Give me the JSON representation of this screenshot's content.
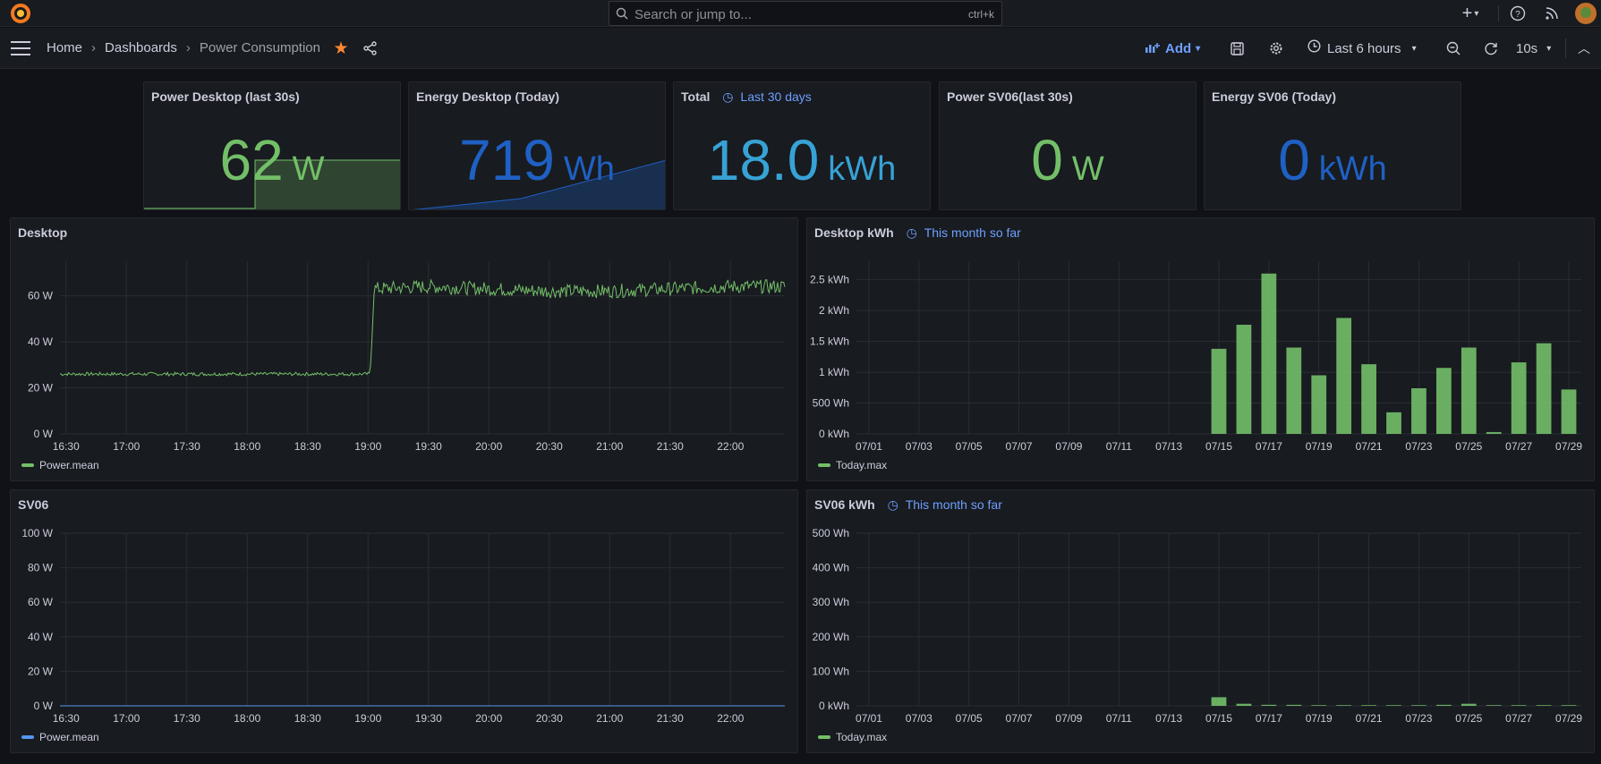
{
  "topbar": {
    "search_placeholder": "Search or jump to...",
    "search_shortcut": "ctrl+k",
    "add_icon": "plus-icon",
    "help_icon": "help-circle-icon",
    "news_icon": "rss-icon"
  },
  "breadcrumb": {
    "home": "Home",
    "dashboards": "Dashboards",
    "current": "Power Consumption"
  },
  "toolbar": {
    "add_label": "Add",
    "time_range": "Last 6 hours",
    "refresh_interval": "10s"
  },
  "colors": {
    "green": "#73bf69",
    "blue": "#1f60c4",
    "lightblue": "#37a2d5",
    "star": "#ff8833",
    "link": "#6e9fff"
  },
  "stat_panels": [
    {
      "title": "Power Desktop (last 30s)",
      "value": "62",
      "unit": "W",
      "color": "#73bf69"
    },
    {
      "title": "Energy Desktop (Today)",
      "value": "719",
      "unit": "Wh",
      "color": "#1f60c4"
    },
    {
      "title": "Total",
      "time_info": "Last 30 days",
      "value": "18.0",
      "unit": "kWh",
      "color": "#37a2d5"
    },
    {
      "title": "Power SV06(last 30s)",
      "value": "0",
      "unit": "W",
      "color": "#73bf69"
    },
    {
      "title": "Energy SV06 (Today)",
      "value": "0",
      "unit": "kWh",
      "color": "#1f60c4"
    }
  ],
  "chart_data": [
    {
      "type": "line",
      "title": "Desktop",
      "legend": "Power.mean",
      "ylim": [
        0,
        75
      ],
      "yticks": [
        "0 W",
        "20 W",
        "40 W",
        "60 W"
      ],
      "ytick_values": [
        0,
        20,
        40,
        60
      ],
      "xticks": [
        "16:30",
        "17:00",
        "17:30",
        "18:00",
        "18:30",
        "19:00",
        "19:30",
        "20:00",
        "20:30",
        "21:00",
        "21:30",
        "22:00"
      ],
      "series": [
        {
          "name": "Power.mean",
          "x": [
            "16:27",
            "17:00",
            "18:00",
            "18:58",
            "19:01",
            "19:03",
            "19:30",
            "20:00",
            "20:30",
            "21:00",
            "21:30",
            "22:00",
            "22:27"
          ],
          "values": [
            26,
            26,
            26,
            26,
            26,
            63,
            64,
            63,
            62,
            62,
            63,
            64,
            64
          ]
        }
      ]
    },
    {
      "type": "bar",
      "title": "Desktop kWh",
      "time_info": "This month so far",
      "legend": "Today.max",
      "ylim": [
        0,
        2.8
      ],
      "yticks": [
        "0 kWh",
        "500 Wh",
        "1 kWh",
        "1.5 kWh",
        "2 kWh",
        "2.5 kWh"
      ],
      "ytick_values": [
        0,
        0.5,
        1,
        1.5,
        2,
        2.5
      ],
      "xticks": [
        "07/01",
        "07/03",
        "07/05",
        "07/07",
        "07/09",
        "07/11",
        "07/13",
        "07/15",
        "07/17",
        "07/19",
        "07/21",
        "07/23",
        "07/25",
        "07/27",
        "07/29"
      ],
      "categories": [
        "07/01",
        "07/02",
        "07/03",
        "07/04",
        "07/05",
        "07/06",
        "07/07",
        "07/08",
        "07/09",
        "07/10",
        "07/11",
        "07/12",
        "07/13",
        "07/14",
        "07/15",
        "07/16",
        "07/17",
        "07/18",
        "07/19",
        "07/20",
        "07/21",
        "07/22",
        "07/23",
        "07/24",
        "07/25",
        "07/26",
        "07/27",
        "07/28",
        "07/29"
      ],
      "values": [
        0,
        0,
        0,
        0,
        0,
        0,
        0,
        0,
        0,
        0,
        0,
        0,
        0,
        0,
        1.38,
        1.77,
        2.6,
        1.4,
        0.95,
        1.88,
        1.13,
        0.35,
        0.74,
        1.07,
        1.4,
        0.03,
        1.16,
        1.47,
        0.72
      ]
    },
    {
      "type": "line",
      "title": "SV06",
      "legend": "Power.mean",
      "ylim": [
        0,
        100
      ],
      "yticks": [
        "0 W",
        "20 W",
        "40 W",
        "60 W",
        "80 W",
        "100 W"
      ],
      "ytick_values": [
        0,
        20,
        40,
        60,
        80,
        100
      ],
      "xticks": [
        "16:30",
        "17:00",
        "17:30",
        "18:00",
        "18:30",
        "19:00",
        "19:30",
        "20:00",
        "20:30",
        "21:00",
        "21:30",
        "22:00"
      ],
      "series": [
        {
          "name": "Power.mean",
          "x": [
            "16:27",
            "22:27"
          ],
          "values": [
            0,
            0
          ]
        }
      ]
    },
    {
      "type": "bar",
      "title": "SV06 kWh",
      "time_info": "This month so far",
      "legend": "Today.max",
      "ylim": [
        0,
        0.5
      ],
      "yticks": [
        "0 kWh",
        "100 Wh",
        "200 Wh",
        "300 Wh",
        "400 Wh",
        "500 Wh"
      ],
      "ytick_values": [
        0,
        0.1,
        0.2,
        0.3,
        0.4,
        0.5
      ],
      "xticks": [
        "07/01",
        "07/03",
        "07/05",
        "07/07",
        "07/09",
        "07/11",
        "07/13",
        "07/15",
        "07/17",
        "07/19",
        "07/21",
        "07/23",
        "07/25",
        "07/27",
        "07/29"
      ],
      "categories": [
        "07/01",
        "07/02",
        "07/03",
        "07/04",
        "07/05",
        "07/06",
        "07/07",
        "07/08",
        "07/09",
        "07/10",
        "07/11",
        "07/12",
        "07/13",
        "07/14",
        "07/15",
        "07/16",
        "07/17",
        "07/18",
        "07/19",
        "07/20",
        "07/21",
        "07/22",
        "07/23",
        "07/24",
        "07/25",
        "07/26",
        "07/27",
        "07/28",
        "07/29"
      ],
      "values": [
        0,
        0,
        0,
        0,
        0,
        0,
        0,
        0,
        0,
        0,
        0,
        0,
        0,
        0,
        0.025,
        0.006,
        0.003,
        0.003,
        0.002,
        0.002,
        0.002,
        0.002,
        0.002,
        0.003,
        0.006,
        0.002,
        0.002,
        0.002,
        0.002
      ]
    }
  ]
}
